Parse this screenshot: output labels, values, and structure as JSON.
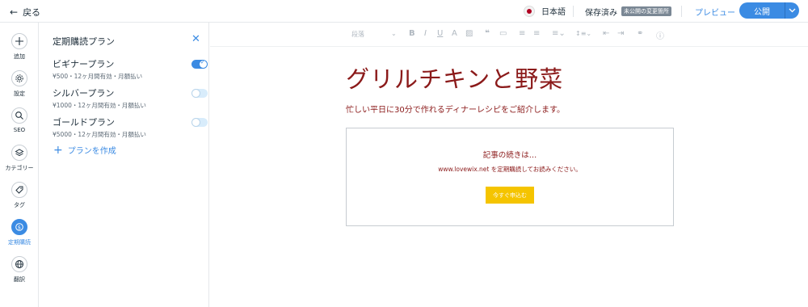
{
  "topbar": {
    "back_label": "戻る",
    "language": "日本語",
    "save_status": "保存済み",
    "unpublished_badge": "未公開の変更箇所",
    "preview_label": "プレビュー",
    "publish_label": "公開"
  },
  "rail": {
    "items": [
      {
        "label": "追加",
        "icon": "plus-icon"
      },
      {
        "label": "設定",
        "icon": "gear-icon"
      },
      {
        "label": "SEO",
        "icon": "search-icon"
      },
      {
        "label": "カテゴリー",
        "icon": "category-icon"
      },
      {
        "label": "タグ",
        "icon": "tag-icon"
      },
      {
        "label": "定期購読",
        "icon": "dollar-icon",
        "active": true
      },
      {
        "label": "翻訳",
        "icon": "globe-icon"
      }
    ]
  },
  "panel": {
    "title": "定期購読プラン",
    "plans": [
      {
        "name": "ビギナープラン",
        "desc": "¥500・12ヶ月間有効・月額払い",
        "enabled": true
      },
      {
        "name": "シルバープラン",
        "desc": "¥1000・12ヶ月間有効・月額払い",
        "enabled": false
      },
      {
        "name": "ゴールドプラン",
        "desc": "¥5000・12ヶ月間有効・月額払い",
        "enabled": false
      }
    ],
    "add_plan_label": "プランを作成"
  },
  "toolbar": {
    "paragraph_style": "段落"
  },
  "post": {
    "title": "グリルチキンと野菜",
    "subtitle": "忙しい平日に30分で作れるディナーレシピをご紹介します。",
    "paywall": {
      "title": "記事の続きは…",
      "text": "www.lovewix.net を定期購読してお読みください。",
      "button": "今すぐ申込む"
    }
  },
  "colors": {
    "accent": "#3b8be3",
    "title_red": "#8b1a1a",
    "button_yellow": "#f5c400"
  }
}
